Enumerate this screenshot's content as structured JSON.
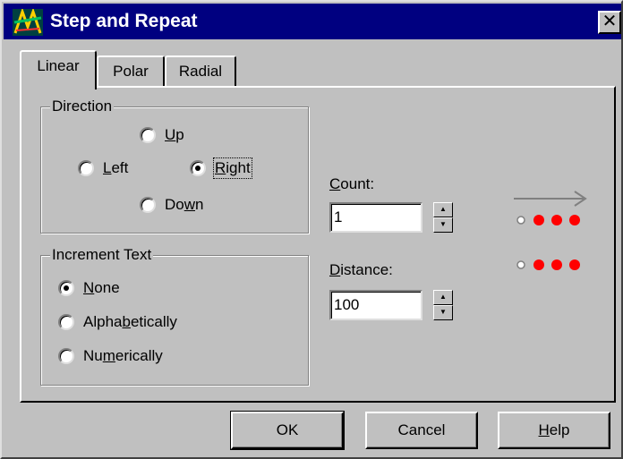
{
  "window": {
    "title": "Step and Repeat",
    "close_glyph": "✕"
  },
  "tabs": [
    {
      "label": "Linear",
      "active": true
    },
    {
      "label": "Polar",
      "active": false
    },
    {
      "label": "Radial",
      "active": false
    }
  ],
  "direction": {
    "title": "Direction",
    "options": {
      "up": {
        "pre": "",
        "key": "U",
        "post": "p",
        "checked": false
      },
      "left": {
        "pre": "",
        "key": "L",
        "post": "eft",
        "checked": false
      },
      "right": {
        "pre": "",
        "key": "R",
        "post": "ight",
        "checked": true
      },
      "down": {
        "pre": "Do",
        "key": "w",
        "post": "n",
        "checked": false
      }
    }
  },
  "increment": {
    "title": "Increment Text",
    "options": {
      "none": {
        "pre": "",
        "key": "N",
        "post": "one",
        "checked": true
      },
      "alpha": {
        "pre": "Alpha",
        "key": "b",
        "post": "etically",
        "checked": false
      },
      "numeric": {
        "pre": "Nu",
        "key": "m",
        "post": "erically",
        "checked": false
      }
    }
  },
  "count": {
    "label_key": "C",
    "label_rest": "ount:",
    "value": "1"
  },
  "distance": {
    "label_key": "D",
    "label_rest": "istance:",
    "value": "100"
  },
  "preview": {
    "arrow_color": "#808080",
    "dot_color": "#ff0000",
    "icon": "direction-preview-icon"
  },
  "buttons": {
    "ok": {
      "label": "OK"
    },
    "cancel": {
      "label": "Cancel"
    },
    "help": {
      "key": "H",
      "rest": "elp"
    }
  }
}
